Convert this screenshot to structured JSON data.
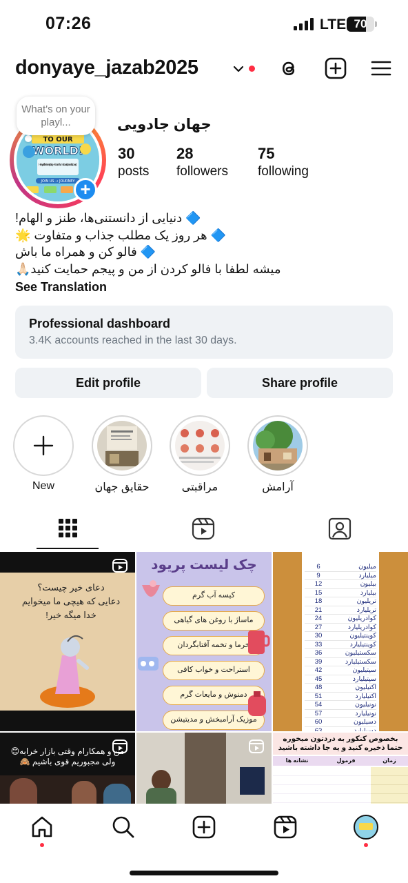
{
  "status_bar": {
    "time": "07:26",
    "network": "LTE",
    "battery": "70",
    "battery_level": 0.7
  },
  "header": {
    "username": "donyaye_jazab2025"
  },
  "profile": {
    "note": "What's on your playl...",
    "display_name": "جهان جادویی",
    "avatar_text": {
      "line1": "TO OUR",
      "line2": "WORLD!",
      "tagline": "Here, you'll find everything — fun and humor to variety and discovery!",
      "join": "JOIN US → JOURNEY"
    },
    "stats": [
      {
        "value": "30",
        "label": "posts"
      },
      {
        "value": "28",
        "label": "followers"
      },
      {
        "value": "75",
        "label": "following"
      }
    ],
    "bio": [
      "🔷 دنیایی از دانستنی‌ها، طنز و الهام!",
      "🔷 هر روز یک مطلب جذاب و متفاوت 🌟",
      "🔷 فالو کن و همراه ما باش",
      "میشه لطفا با فالو کردن از من و پیجم حمایت کنید🙏🏻"
    ],
    "see_translation": "See Translation"
  },
  "dashboard": {
    "title": "Professional dashboard",
    "subtitle": "3.4K accounts reached in the last 30 days."
  },
  "buttons": {
    "edit": "Edit profile",
    "share": "Share profile"
  },
  "highlights": [
    {
      "label": "New",
      "icon": "plus-icon"
    },
    {
      "label": "حقایق جهان"
    },
    {
      "label": "مراقبتی"
    },
    {
      "label": "آرامش"
    }
  ],
  "tabs": [
    {
      "name": "grid",
      "icon": "grid-icon",
      "active": true
    },
    {
      "name": "reels",
      "icon": "reels-icon"
    },
    {
      "name": "tagged",
      "icon": "tagged-icon"
    }
  ],
  "posts": {
    "p1": {
      "lines": [
        "دعای خیر چیست؟",
        "دعایی که هیچی ما میخوایم",
        "خدا میگه خیر!"
      ]
    },
    "p2": {
      "title": "چک لیست پریود",
      "items": [
        "کیسه آب گرم",
        "ماساژ با روغن های گیاهی",
        "خرما و تخمه آفتابگردان",
        "استراحت و خواب کافی",
        "دمنوش و مایعات گرم",
        "موزیک آرامبخش و مدیتیشن"
      ]
    },
    "p3": {
      "rows": [
        [
          "6",
          "میلیون"
        ],
        [
          "9",
          "میلیارد"
        ],
        [
          "12",
          "بیلیون"
        ],
        [
          "15",
          "بیلیارد"
        ],
        [
          "18",
          "تریلیون"
        ],
        [
          "21",
          "تریلیارد"
        ],
        [
          "24",
          "کوادریلیون"
        ],
        [
          "27",
          "کوادریلیارد"
        ],
        [
          "30",
          "کوینتیلیون"
        ],
        [
          "33",
          "کوینتیلیارد"
        ],
        [
          "36",
          "سکستیلیون"
        ],
        [
          "39",
          "سکستیلیارد"
        ],
        [
          "42",
          "سپتیلیون"
        ],
        [
          "45",
          "سپتیلیارد"
        ],
        [
          "48",
          "اکتیلیون"
        ],
        [
          "51",
          "اکتیلیارد"
        ],
        [
          "54",
          "نونیلیون"
        ],
        [
          "57",
          "نونیلیارد"
        ],
        [
          "60",
          "دسیلیون"
        ],
        [
          "63",
          "دسیلیارد"
        ]
      ]
    },
    "p4": {
      "lines": [
        "من و همکارام وقتی بازار خرابه😊",
        "ولی مجبوریم قوی باشیم 🙈"
      ]
    },
    "p6": {
      "lines": [
        "بخصوص کنکور به دردتون میخوره",
        "حتما ذخیره کنید و یه جا داشته باشید"
      ],
      "headers": [
        "زمان",
        "فرمول",
        "نشانه ها"
      ]
    }
  },
  "colors": {
    "accent": "#1d8cf0",
    "notification": "#ff2e43",
    "surface": "#eff2f5"
  }
}
